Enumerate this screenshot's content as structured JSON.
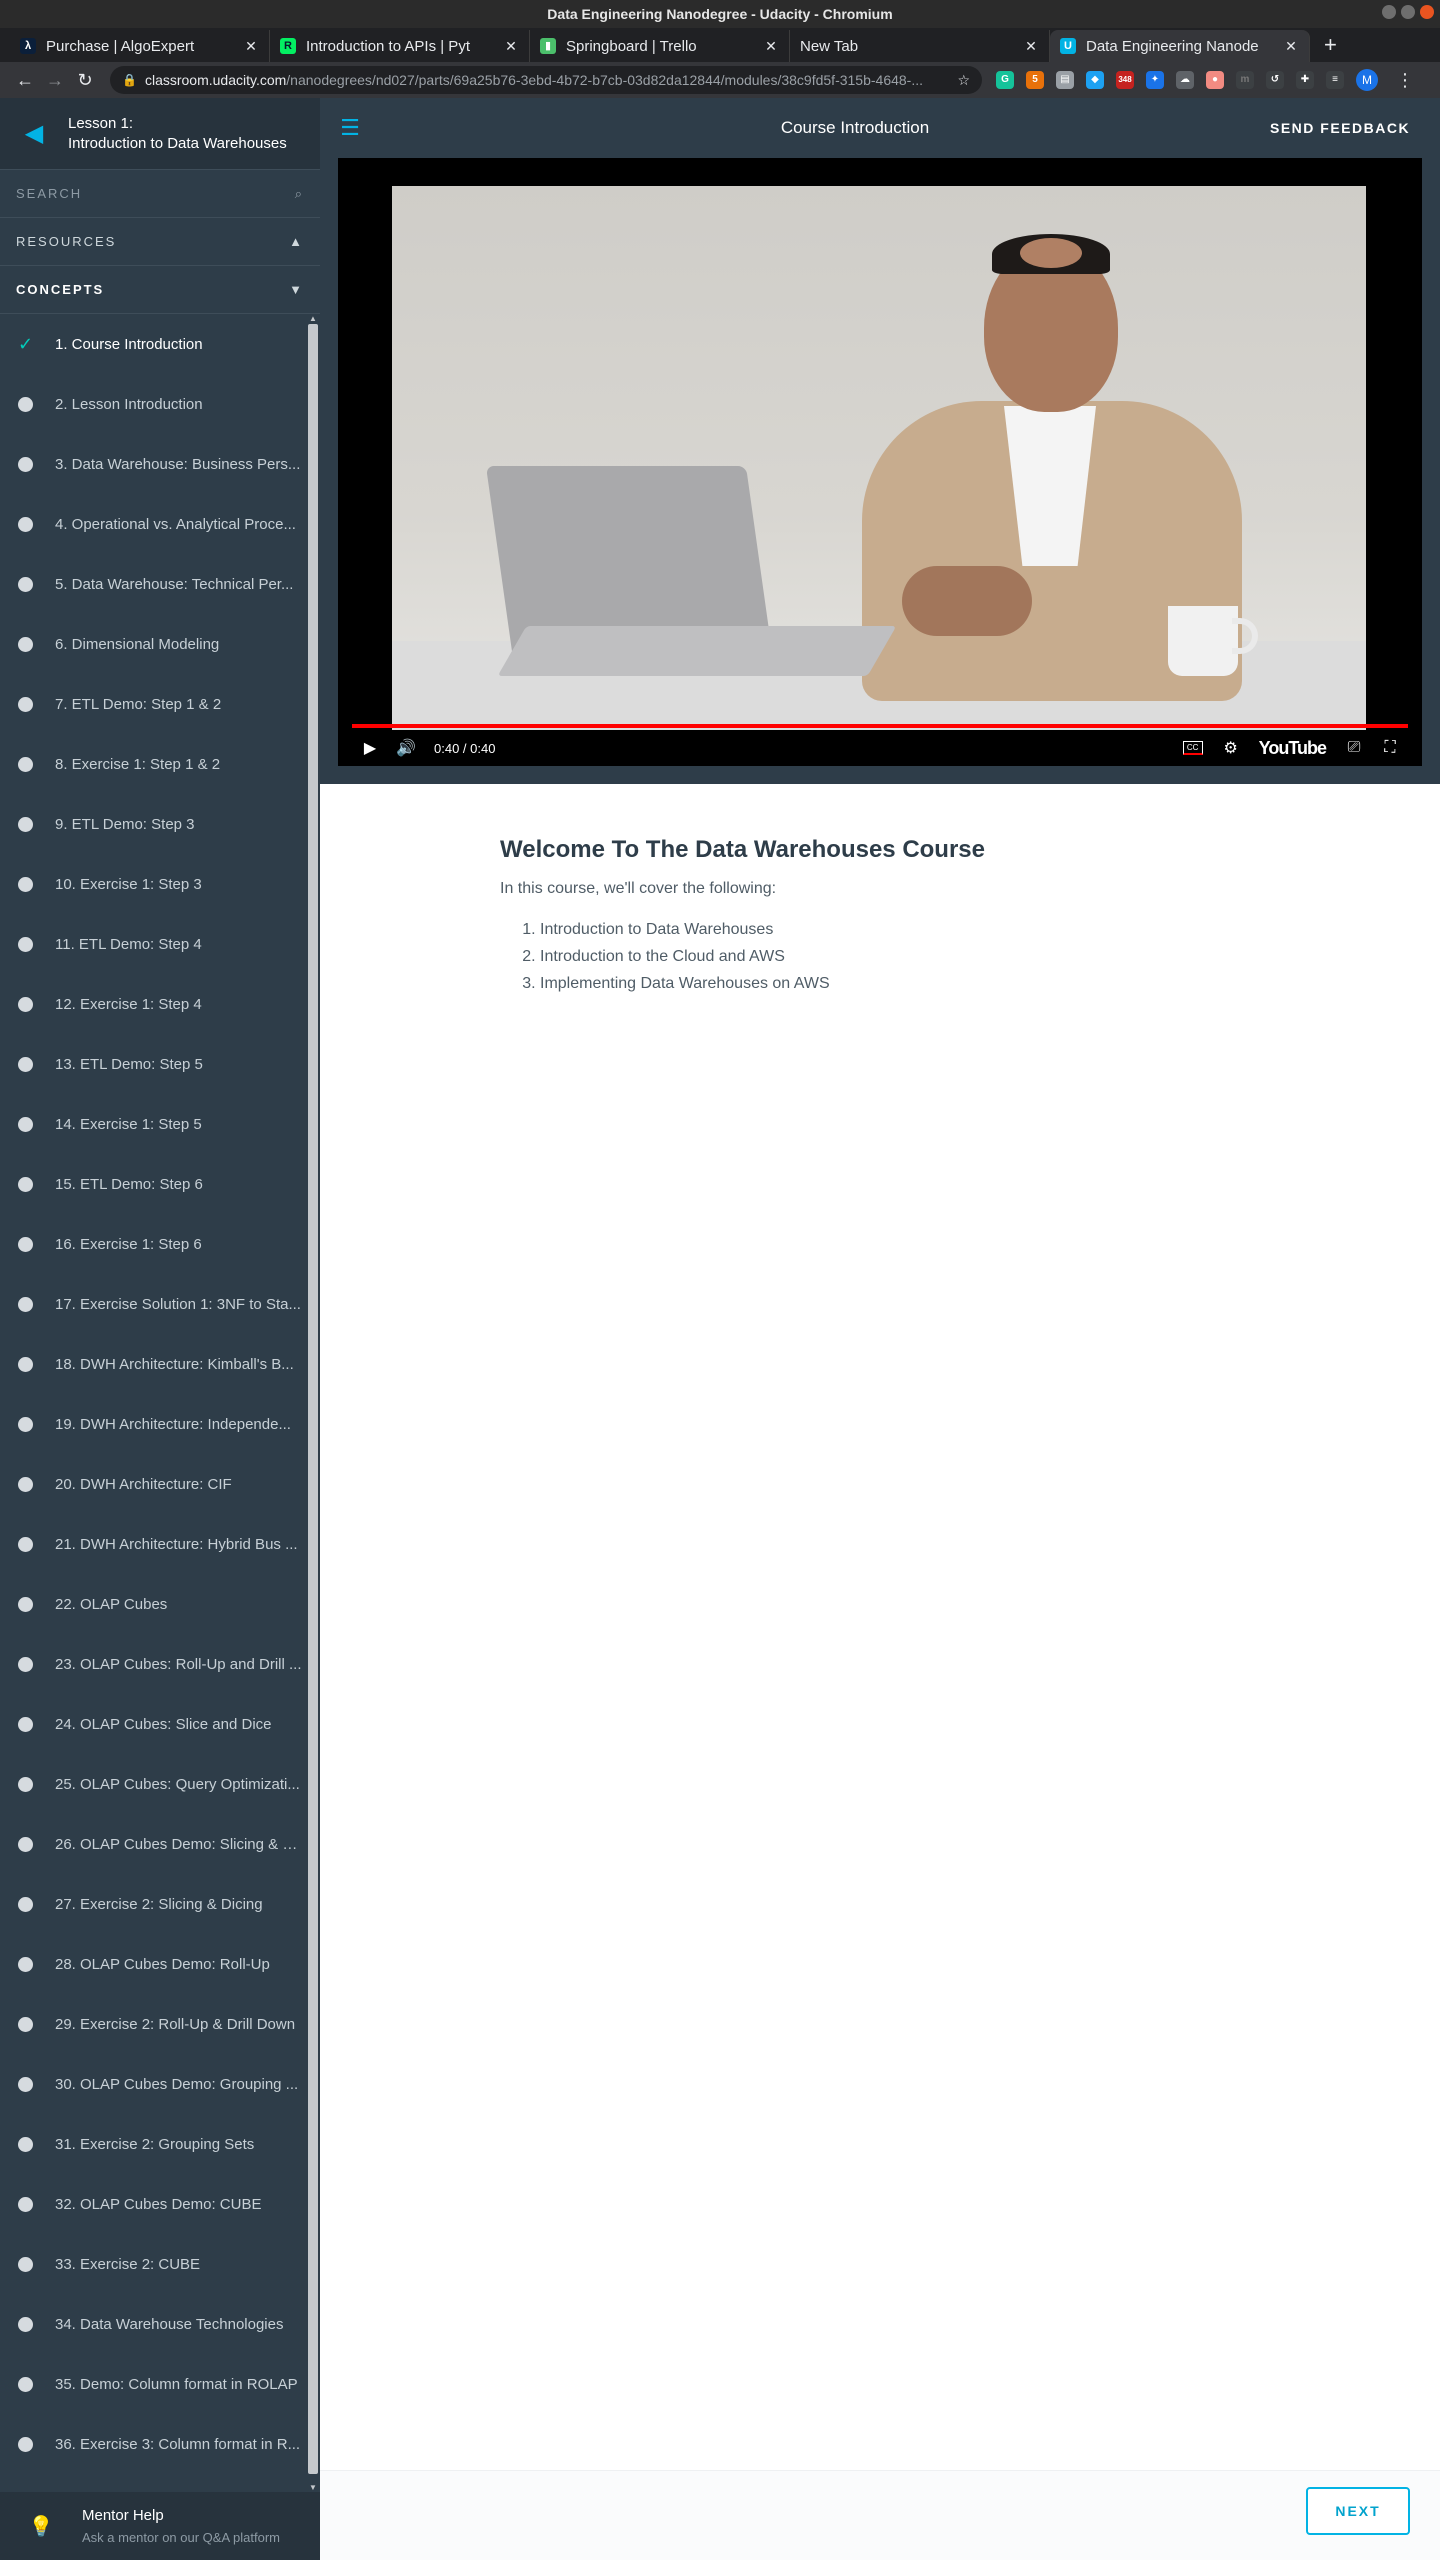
{
  "window": {
    "title": "Data Engineering Nanodegree - Udacity - Chromium"
  },
  "tabs": [
    {
      "title": "Purchase | AlgoExpert",
      "favicon": "algoexpert-icon",
      "color": "#0b1f3a",
      "glyph": "λ"
    },
    {
      "title": "Introduction to APIs | Pyt",
      "favicon": "datacamp-icon",
      "color": "#03ef62",
      "glyph": "R"
    },
    {
      "title": "Springboard | Trello",
      "favicon": "trello-icon",
      "color": "#4bbf6b",
      "glyph": "▮"
    },
    {
      "title": "New Tab",
      "favicon": "",
      "color": "",
      "glyph": ""
    },
    {
      "title": "Data Engineering Nanode",
      "favicon": "udacity-icon",
      "color": "#02b3e4",
      "glyph": "U"
    }
  ],
  "address": {
    "host": "classroom.udacity.com",
    "path": "/nanodegrees/nd027/parts/69a25b76-3ebd-4b72-b7cb-03d82da12844/modules/38c9fd5f-315b-4648-..."
  },
  "extensions": {
    "badge": "348",
    "profile_initial": "M"
  },
  "sidebar": {
    "lesson_line1": "Lesson 1:",
    "lesson_line2": "Introduction to Data Warehouses",
    "search_label": "SEARCH",
    "resources_label": "RESOURCES",
    "concepts_label": "CONCEPTS",
    "concepts": [
      "1. Course Introduction",
      "2. Lesson Introduction",
      "3. Data Warehouse: Business Pers...",
      "4. Operational vs. Analytical Proce...",
      "5. Data Warehouse: Technical Per...",
      "6. Dimensional Modeling",
      "7. ETL Demo: Step 1 & 2",
      "8. Exercise 1: Step 1 & 2",
      "9. ETL Demo: Step 3",
      "10. Exercise 1: Step 3",
      "11. ETL Demo: Step 4",
      "12. Exercise 1: Step 4",
      "13. ETL Demo: Step 5",
      "14. Exercise 1: Step 5",
      "15. ETL Demo: Step 6",
      "16. Exercise 1: Step 6",
      "17. Exercise Solution 1: 3NF to Sta...",
      "18. DWH Architecture: Kimball's B...",
      "19. DWH Architecture: Independe...",
      "20. DWH Architecture: CIF",
      "21. DWH Architecture: Hybrid Bus ...",
      "22. OLAP Cubes",
      "23. OLAP Cubes: Roll-Up and Drill ...",
      "24. OLAP Cubes: Slice and Dice",
      "25. OLAP Cubes: Query Optimizati...",
      "26. OLAP Cubes Demo: Slicing & D...",
      "27. Exercise 2: Slicing & Dicing",
      "28. OLAP Cubes Demo: Roll-Up",
      "29. Exercise 2: Roll-Up & Drill Down",
      "30. OLAP Cubes Demo: Grouping ...",
      "31. Exercise 2: Grouping Sets",
      "32. OLAP Cubes Demo: CUBE",
      "33. Exercise 2: CUBE",
      "34. Data Warehouse Technologies",
      "35. Demo: Column format in ROLAP",
      "36. Exercise 3: Column format in R..."
    ],
    "mentor_title": "Mentor Help",
    "mentor_sub": "Ask a mentor on our Q&A platform"
  },
  "topbar": {
    "title": "Course Introduction",
    "feedback": "SEND FEEDBACK"
  },
  "video": {
    "time": "0:40 / 0:40",
    "progress": 1.0,
    "brand": "YouTube"
  },
  "content": {
    "heading": "Welcome To The Data Warehouses Course",
    "intro": "In this course, we'll cover the following:",
    "items": [
      "Introduction to Data Warehouses",
      "Introduction to the Cloud and AWS",
      "Implementing Data Warehouses on AWS"
    ]
  },
  "footer": {
    "next_label": "NEXT"
  }
}
